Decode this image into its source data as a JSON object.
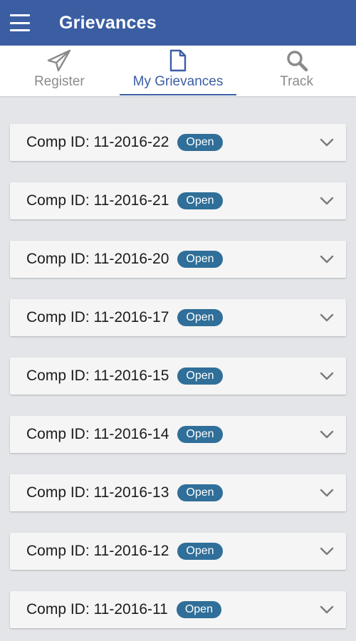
{
  "appbar": {
    "title": "Grievances",
    "menu_icon": "hamburger-menu-icon",
    "bg_color": "#3b5ea3"
  },
  "tabs": [
    {
      "label": "Register",
      "icon": "paper-plane-icon",
      "active": false
    },
    {
      "label": "My Grievances",
      "icon": "document-icon",
      "active": true
    },
    {
      "label": "Track",
      "icon": "search-icon",
      "active": false
    }
  ],
  "grievances": [
    {
      "title": "Comp ID: 11-2016-22",
      "status": "Open"
    },
    {
      "title": "Comp ID: 11-2016-21",
      "status": "Open"
    },
    {
      "title": "Comp ID: 11-2016-20",
      "status": "Open"
    },
    {
      "title": "Comp ID: 11-2016-17",
      "status": "Open"
    },
    {
      "title": "Comp ID: 11-2016-15",
      "status": "Open"
    },
    {
      "title": "Comp ID: 11-2016-14",
      "status": "Open"
    },
    {
      "title": "Comp ID: 11-2016-13",
      "status": "Open"
    },
    {
      "title": "Comp ID: 11-2016-12",
      "status": "Open"
    },
    {
      "title": "Comp ID: 11-2016-11",
      "status": "Open"
    }
  ],
  "colors": {
    "accent": "#3b5ea3",
    "badge": "#2f6f99",
    "background": "#e3e5e8",
    "card": "#f5f5f5"
  }
}
